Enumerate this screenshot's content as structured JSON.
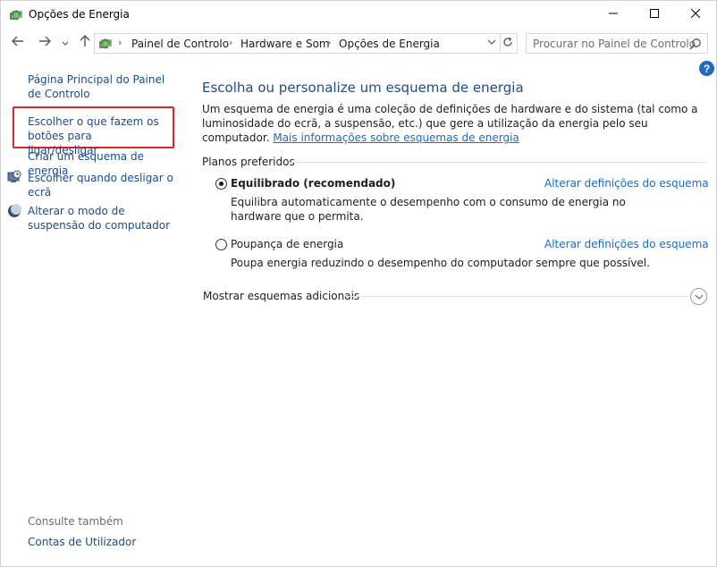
{
  "window": {
    "title": "Opções de Energia",
    "app_icon": "power-options-icon",
    "controls": {
      "minimize": "minimize-icon",
      "maximize": "maximize-icon",
      "close": "close-icon"
    }
  },
  "navigation": {
    "back_icon": "arrow-left-icon",
    "forward_icon": "arrow-right-icon",
    "recent_icon": "chevron-down-icon",
    "up_icon": "arrow-up-icon",
    "breadcrumbs": [
      "Painel de Controlo",
      "Hardware e Som",
      "Opções de Energia"
    ],
    "refresh_icon": "refresh-icon",
    "search_placeholder": "Procurar no Painel de Controlo"
  },
  "sidebar": {
    "home_link": "Página Principal do Painel de Controlo",
    "items": [
      {
        "label": "Escolher o que fazem os botões para ligar/desligar",
        "icon": "",
        "highlighted": true
      },
      {
        "label": "Criar um esquema de energia",
        "icon": ""
      },
      {
        "label": "Escolher quando desligar o ecrã",
        "icon": "monitor-clock-icon"
      },
      {
        "label": "Alterar o modo de suspensão do computador",
        "icon": "moon-icon"
      }
    ],
    "see_also_title": "Consulte também",
    "see_also_links": [
      "Contas de Utilizador"
    ]
  },
  "main": {
    "title": "Escolha ou personalize um esquema de energia",
    "description": "Um esquema de energia é uma coleção de definições de hardware e do sistema (tal como a luminosidade do ecrã, a suspensão, etc.) que gere a utilização da energia pelo seu computador.",
    "more_info_link": "Mais informações sobre esquemas de energia",
    "preferred_plans_label": "Planos preferidos",
    "plans": [
      {
        "name": "Equilibrado (recomendado)",
        "selected": true,
        "change_link": "Alterar definições do esquema",
        "description": "Equilibra automaticamente o desempenho com o consumo de energia no hardware que o permita."
      },
      {
        "name": "Poupança de energia",
        "selected": false,
        "change_link": "Alterar definições do esquema",
        "description": "Poupa energia reduzindo o desempenho do computador sempre que possível."
      }
    ],
    "show_more_label": "Mostrar esquemas adicionais"
  },
  "colors": {
    "link": "#1e68c8",
    "heading": "#1e4c8a",
    "highlight": "#e0242a",
    "help": "#1e68c8"
  }
}
